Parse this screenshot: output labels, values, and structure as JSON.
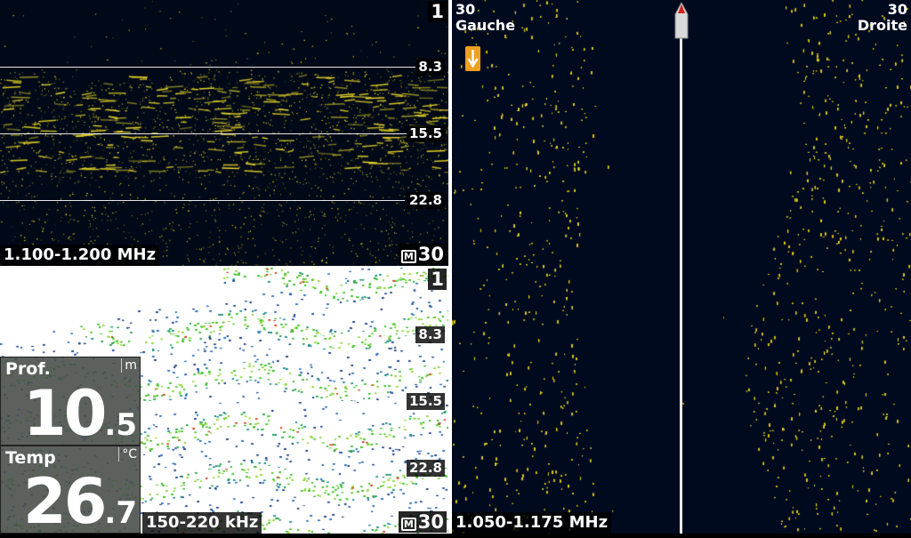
{
  "downview": {
    "page_number": "1",
    "depth_markers": [
      "8.3",
      "15.5",
      "22.8"
    ],
    "frequency": "1.100-1.200 MHz",
    "range_icon": "M",
    "range": "30"
  },
  "sonar2d": {
    "page_number": "1",
    "depth_markers": [
      "8.3",
      "15.5",
      "22.8"
    ],
    "frequency": "150-220 kHz",
    "range_icon": "M",
    "range": "30"
  },
  "depth_box": {
    "label": "Prof.",
    "unit": "m",
    "value_int": "10",
    "value_dec": ".5"
  },
  "temp_box": {
    "label": "Temp",
    "unit": "°C",
    "value_int": "26",
    "value_dec": ".7"
  },
  "sideview": {
    "left_range": "30",
    "left_label": "Gauche",
    "right_range": "30",
    "right_label": "Droite",
    "frequency": "1.050-1.175 MHz",
    "icons": [
      "boat-icon",
      "down-arrow-icon"
    ]
  },
  "colors": {
    "sonar_yellow": "#e6d21e",
    "dark_background": "#000a1f",
    "twod_green": "#3ec02a",
    "twod_blue": "#1b3f8a"
  }
}
